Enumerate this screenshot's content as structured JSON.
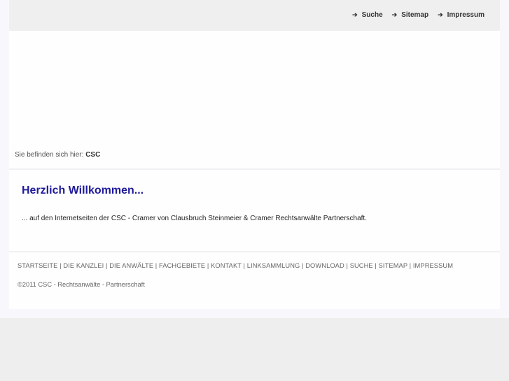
{
  "top_links": [
    "Suche",
    "Sitemap",
    "Impressum"
  ],
  "breadcrumb": {
    "prefix": "Sie befinden sich hier:",
    "current": "CSC"
  },
  "heading": "Herzlich Willkommen...",
  "intro": "... auf den Internetseiten der CSC - Cramer von Clausbruch Steinmeier & Cramer Rechtsanwälte Partnerschaft.",
  "footer_nav": [
    "STARTSEITE",
    "DIE KANZLEI",
    "DIE ANWÄLTE",
    "FACHGEBIETE",
    "KONTAKT",
    "LINKSAMMLUNG",
    "DOWNLOAD",
    "SUCHE",
    "SITEMAP",
    "IMPRESSUM"
  ],
  "footer_separator": " | ",
  "copyright": "©2011 CSC - Rechtsanwälte - Partnerschaft",
  "colors": {
    "heading": "#1f1a99",
    "topbar": "#efefef"
  }
}
